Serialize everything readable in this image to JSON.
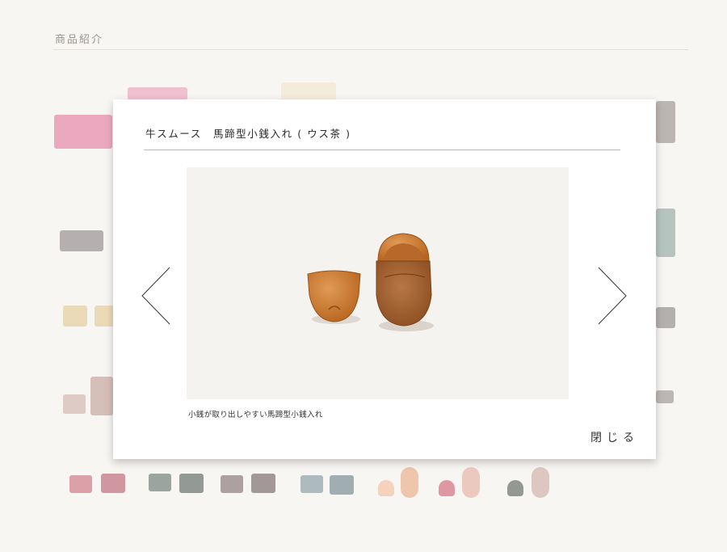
{
  "page": {
    "section_title": "商品紹介"
  },
  "modal": {
    "title": "牛スムース　馬蹄型小銭入れ ( ウス茶 )",
    "caption": "小銭が取り出しやすい馬蹄型小銭入れ",
    "close_label": "閉じる",
    "prev_icon": "chevron-left-icon",
    "next_icon": "chevron-right-icon"
  },
  "colors": {
    "background": "#f8f6f3",
    "accent_leather": "#c9782f",
    "text": "#2b2b2b"
  }
}
